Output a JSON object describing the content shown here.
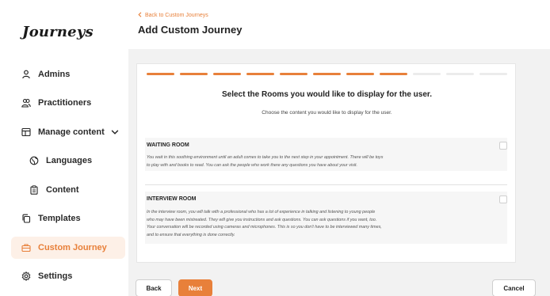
{
  "app": {
    "logo_text": "Journeys"
  },
  "sidebar": {
    "items": [
      {
        "label": "Admins",
        "icon": "person-icon"
      },
      {
        "label": "Practitioners",
        "icon": "people-icon"
      },
      {
        "label": "Manage content",
        "icon": "content-icon"
      },
      {
        "label": "Languages",
        "icon": "globe-icon"
      },
      {
        "label": "Content",
        "icon": "clipboard-icon"
      },
      {
        "label": "Templates",
        "icon": "copy-icon"
      },
      {
        "label": "Custom Journey",
        "icon": "briefcase-icon",
        "active": true
      },
      {
        "label": "Settings",
        "icon": "gear-icon"
      }
    ]
  },
  "header": {
    "back_link": "Back to Custom Journeys",
    "title": "Add Custom Journey"
  },
  "card": {
    "progress": {
      "total_steps": 11,
      "completed_steps": 8
    },
    "heading": "Select the Rooms you would like to display for the user.",
    "subheading": "Choose the content you would like to display for the user.",
    "rooms": [
      {
        "title": "WAITING ROOM",
        "checked": false,
        "lines": [
          "You wait in this soothing environment until an adult comes to take you to the next step in your appointment. There will be toys",
          "to play with and books to read. You can ask the people who work there any questions you have about your visit."
        ]
      },
      {
        "title": "INTERVIEW ROOM",
        "checked": false,
        "lines": [
          "In the interview room, you will talk with a professional who has a lot of experience in talking and listening to young people",
          "who may have been mistreated. They will give you instructions and ask questions. You can ask questions if you want, too.",
          "Your conversation will be recorded using cameras and microphones. This is so you don't have to be interviewed many times,",
          "and to ensure that everything is done correctly."
        ]
      }
    ]
  },
  "footer": {
    "back_label": "Back",
    "next_label": "Next",
    "cancel_label": "Cancel"
  },
  "colors": {
    "accent": "#e8803a",
    "active_bg": "#fdf0e7",
    "main_bg": "#f2f2f2"
  }
}
